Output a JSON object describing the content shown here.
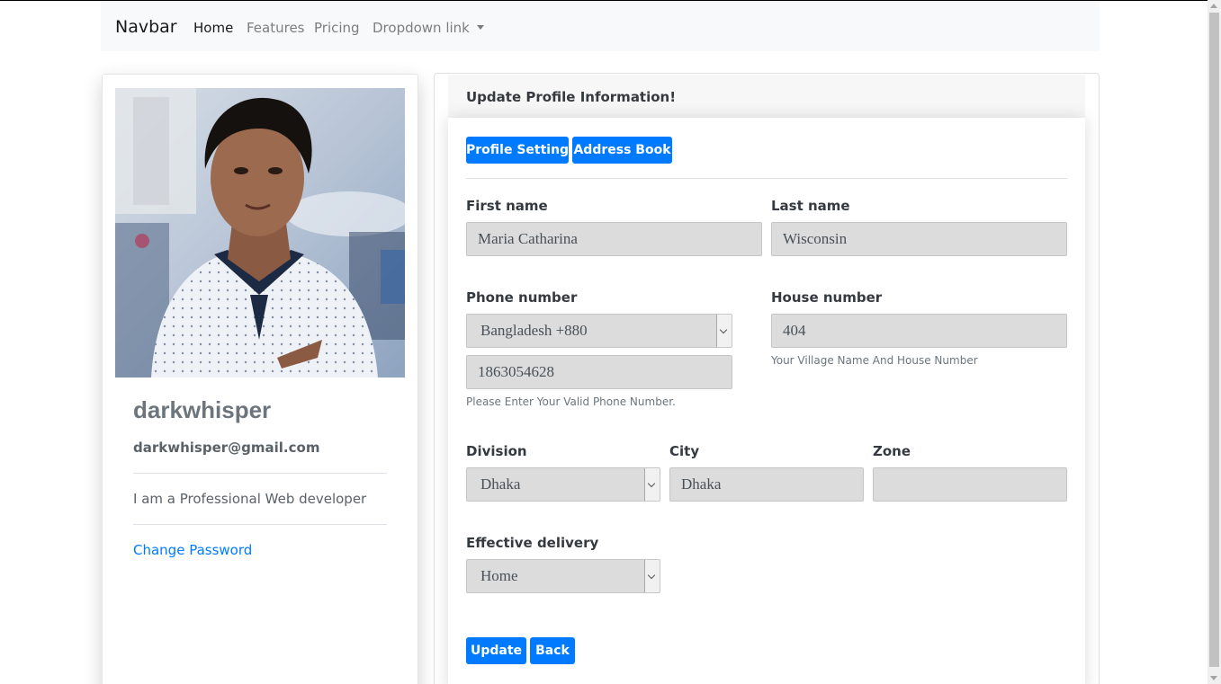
{
  "navbar": {
    "brand": "Navbar",
    "links": [
      {
        "label": "Home",
        "active": true
      },
      {
        "label": "Features",
        "active": false
      },
      {
        "label": "Pricing",
        "active": false
      },
      {
        "label": "Dropdown link",
        "active": false
      }
    ]
  },
  "profile": {
    "username": "darkwhisper",
    "email": "darkwhisper@gmail.com",
    "bio": "I am a Professional Web developer",
    "change_password": "Change Password"
  },
  "form": {
    "title": "Update Profile Information!",
    "tabs": {
      "profile_setting": "Profile Setting",
      "address_book": "Address Book"
    },
    "first_name": {
      "label": "First name",
      "value": "Maria Catharina"
    },
    "last_name": {
      "label": "Last name",
      "value": "Wisconsin"
    },
    "phone": {
      "label": "Phone number",
      "country": "Bangladesh +880",
      "value": "1863054628",
      "help": "Please Enter Your Valid Phone Number."
    },
    "house": {
      "label": "House number",
      "value": "404",
      "help": "Your Village Name And House Number"
    },
    "division": {
      "label": "Division",
      "value": "Dhaka"
    },
    "city": {
      "label": "City",
      "value": "Dhaka"
    },
    "zone": {
      "label": "Zone",
      "value": ""
    },
    "delivery": {
      "label": "Effective delivery",
      "value": "Home"
    },
    "buttons": {
      "update": "Update",
      "back": "Back"
    }
  },
  "colors": {
    "primary": "#007bff",
    "field_bg": "#dcdcdc",
    "navbar_bg": "#f8f9fa",
    "muted": "#6c757d"
  }
}
